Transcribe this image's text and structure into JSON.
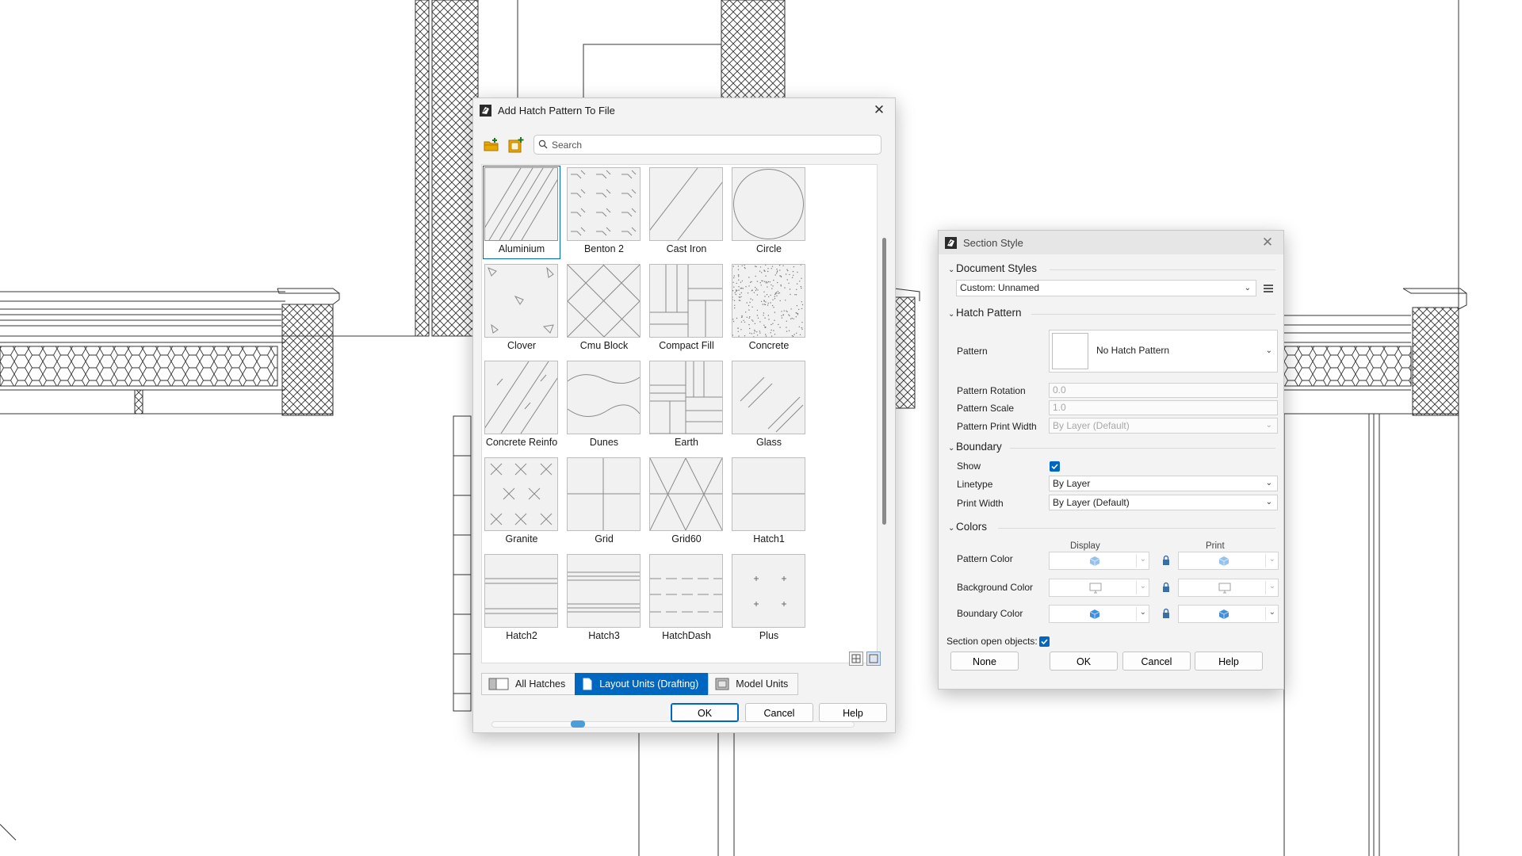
{
  "hatch_dialog": {
    "title": "Add Hatch Pattern To File",
    "search_placeholder": "Search",
    "patterns": [
      {
        "label": "Aluminium",
        "icon": "aluminium-pattern",
        "selected": true
      },
      {
        "label": "Benton 2",
        "icon": "benton-2-pattern"
      },
      {
        "label": "Cast Iron",
        "icon": "cast-iron-pattern"
      },
      {
        "label": "Circle",
        "icon": "circle-pattern"
      },
      {
        "label": "Clover",
        "icon": "clover-pattern"
      },
      {
        "label": "Cmu Block",
        "icon": "cmu-block-pattern"
      },
      {
        "label": "Compact Fill",
        "icon": "compact-fill-pattern"
      },
      {
        "label": "Concrete",
        "icon": "concrete-pattern"
      },
      {
        "label": "Concrete Reinfo",
        "icon": "concrete-reinfo-pattern"
      },
      {
        "label": "Dunes",
        "icon": "dunes-pattern"
      },
      {
        "label": "Earth",
        "icon": "earth-pattern"
      },
      {
        "label": "Glass",
        "icon": "glass-pattern"
      },
      {
        "label": "Granite",
        "icon": "granite-pattern"
      },
      {
        "label": "Grid",
        "icon": "grid-pattern"
      },
      {
        "label": "Grid60",
        "icon": "grid60-pattern"
      },
      {
        "label": "Hatch1",
        "icon": "hatch1-pattern"
      },
      {
        "label": "Hatch2",
        "icon": "hatch2-pattern"
      },
      {
        "label": "Hatch3",
        "icon": "hatch3-pattern"
      },
      {
        "label": "HatchDash",
        "icon": "hatchdash-pattern"
      },
      {
        "label": "Plus",
        "icon": "plus-pattern"
      }
    ],
    "unit_tabs": [
      {
        "label": "All Hatches",
        "active": false
      },
      {
        "label": "Layout Units (Drafting)",
        "active": true
      },
      {
        "label": "Model Units",
        "active": false
      }
    ],
    "buttons": {
      "ok": "OK",
      "cancel": "Cancel",
      "help": "Help"
    }
  },
  "section_dialog": {
    "title": "Section Style",
    "document_styles": {
      "heading": "Document Styles",
      "value": "Custom: Unnamed"
    },
    "hatch_pattern": {
      "heading": "Hatch Pattern",
      "pattern_label": "Pattern",
      "pattern_value": "No Hatch Pattern",
      "rotation_label": "Pattern Rotation",
      "rotation_value": "0.0",
      "scale_label": "Pattern Scale",
      "scale_value": "1.0",
      "print_width_label": "Pattern Print Width",
      "print_width_value": "By Layer (Default)"
    },
    "boundary": {
      "heading": "Boundary",
      "show_label": "Show",
      "show_checked": true,
      "linetype_label": "Linetype",
      "linetype_value": "By Layer",
      "print_width_label": "Print Width",
      "print_width_value": "By Layer (Default)"
    },
    "colors": {
      "heading": "Colors",
      "display_header": "Display",
      "print_header": "Print",
      "pattern_color_label": "Pattern Color",
      "background_color_label": "Background Color",
      "boundary_color_label": "Boundary Color"
    },
    "section_open_label": "Section open objects:",
    "section_open_checked": true,
    "buttons": {
      "none": "None",
      "ok": "OK",
      "cancel": "Cancel",
      "help": "Help"
    }
  },
  "colors": {
    "accent": "#0067c0",
    "dialog_bg": "#f3f3f3"
  }
}
